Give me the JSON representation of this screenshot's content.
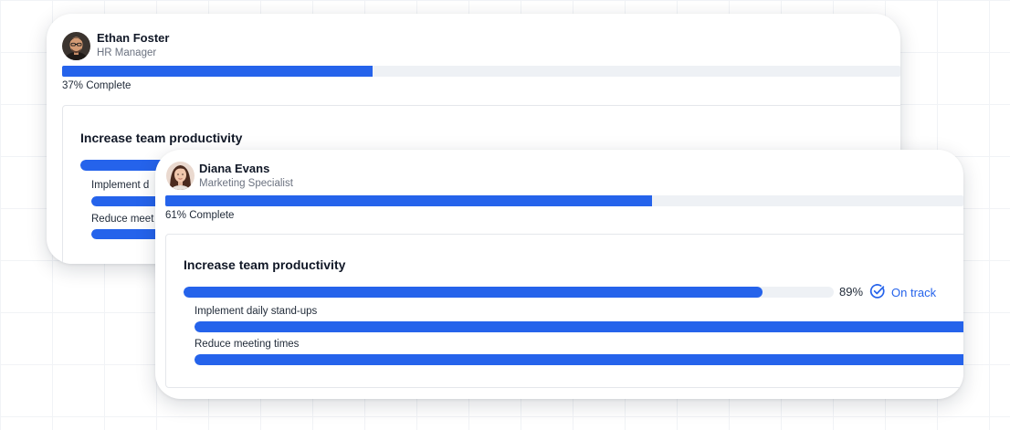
{
  "cards": [
    {
      "user": {
        "name": "Ethan Foster",
        "role": "HR Manager",
        "avatar_icon": "avatar-photo-man"
      },
      "progress": {
        "value": 0.37,
        "label": "37% Complete"
      },
      "goal": {
        "title": "Increase team productivity",
        "progress": 0.89,
        "tasks": [
          {
            "label": "Implement d",
            "progress": 1.0
          },
          {
            "label": "Reduce meet",
            "progress": 1.0
          }
        ]
      }
    },
    {
      "user": {
        "name": "Diana Evans",
        "role": "Marketing Specialist",
        "avatar_icon": "avatar-photo-woman"
      },
      "progress": {
        "value": 0.61,
        "label": "61% Complete"
      },
      "goal": {
        "title": "Increase team productivity",
        "progress": 0.89,
        "percent_label": "89%",
        "status": {
          "label": "On track",
          "icon": "check-circle-icon",
          "color": "#2563eb"
        },
        "tasks": [
          {
            "label": "Implement daily stand-ups",
            "progress": 1.0
          },
          {
            "label": "Reduce meeting times",
            "progress": 1.0
          }
        ]
      }
    }
  ],
  "colors": {
    "accent": "#2563eb",
    "track": "#eef1f5",
    "text": "#111827",
    "muted": "#6b7280"
  }
}
